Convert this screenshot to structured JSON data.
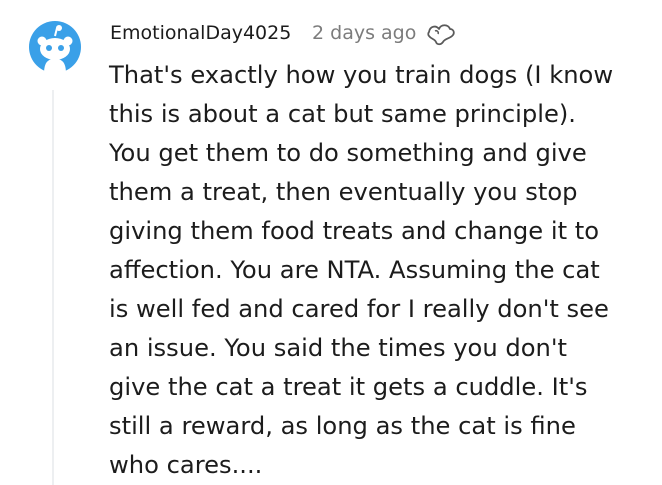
{
  "comment": {
    "author": "EmotionalDay4025",
    "time": "2 days ago",
    "award_icon": "award-badge-icon",
    "avatar_icon": "snoo-avatar-icon",
    "lines": [
      "That's exactly how you train dogs (I know",
      "this is about a cat but same principle).",
      "You get them to do something and give",
      "them a treat, then eventually you stop",
      "giving them food treats and change it to",
      "affection. You are NTA. Assuming the cat",
      "is well fed and cared for I really don't see",
      "an issue. You said the times you don't",
      "give the cat a treat it gets a cuddle. It's",
      "still a reward, as long as the cat is fine",
      "who cares...."
    ]
  },
  "colors": {
    "avatar_bg": "#3aa0e8",
    "text": "#1c1c1c",
    "meta": "#7c7c7c",
    "thread_line": "#edeff1"
  }
}
